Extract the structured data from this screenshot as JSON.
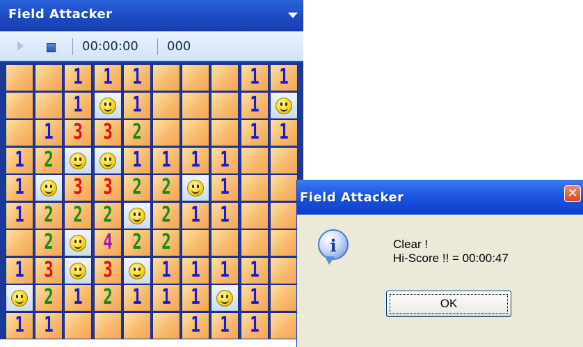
{
  "game": {
    "title": "Field Attacker",
    "toolbar": {
      "time": "00:00:00",
      "count": "000"
    },
    "board": {
      "rows": [
        [
          " ",
          " ",
          "1",
          "1",
          "1",
          " ",
          " ",
          " ",
          "1",
          "1"
        ],
        [
          " ",
          " ",
          "1",
          "S",
          "1",
          " ",
          " ",
          " ",
          "1",
          "S"
        ],
        [
          " ",
          "1",
          "3",
          "3",
          "2",
          " ",
          " ",
          " ",
          "1",
          "1"
        ],
        [
          "1",
          "2",
          "S",
          "S",
          "1",
          "1",
          "1",
          "1",
          " ",
          " "
        ],
        [
          "1",
          "S",
          "3",
          "3",
          "2",
          "2",
          "S",
          "1",
          " ",
          " "
        ],
        [
          "1",
          "2",
          "2",
          "2",
          "S",
          "2",
          "1",
          "1",
          " ",
          " "
        ],
        [
          " ",
          "2",
          "S",
          "4",
          "2",
          "2",
          " ",
          " ",
          " ",
          " "
        ],
        [
          "1",
          "3",
          "S",
          "3",
          "S",
          "1",
          "1",
          "1",
          "1",
          " "
        ],
        [
          "S",
          "2",
          "1",
          "2",
          "1",
          "1",
          "1",
          "S",
          "1",
          " "
        ],
        [
          "1",
          "1",
          " ",
          " ",
          " ",
          " ",
          "1",
          "1",
          "1",
          " "
        ]
      ]
    }
  },
  "dialog": {
    "title": "Field Attacker",
    "message_line1": "Clear !",
    "message_line2": "Hi-Score !! = 00:00:47",
    "ok_label": "OK",
    "icon": "info-icon"
  }
}
